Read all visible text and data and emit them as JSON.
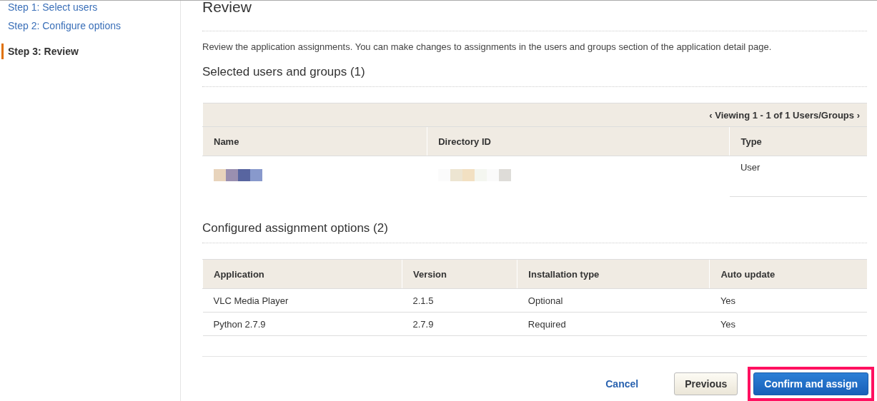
{
  "sidebar": {
    "steps": [
      {
        "label": "Step 1: Select users",
        "selected": false
      },
      {
        "label": "Step 2: Configure options",
        "selected": false
      },
      {
        "label": "Step 3: Review",
        "selected": true
      }
    ]
  },
  "page": {
    "title": "Review",
    "description": "Review the application assignments. You can make changes to assignments in the users and groups section of the application detail page."
  },
  "users_section": {
    "title": "Selected users and groups (1)",
    "pager": {
      "prev": "‹",
      "text": "Viewing 1 - 1 of 1 Users/Groups",
      "next": "›"
    },
    "columns": [
      "Name",
      "Directory ID",
      "Type"
    ],
    "rows": [
      {
        "type": "User"
      }
    ]
  },
  "options_section": {
    "title": "Configured assignment options (2)",
    "columns": [
      "Application",
      "Version",
      "Installation type",
      "Auto update"
    ],
    "rows": [
      [
        "VLC Media Player",
        "2.1.5",
        "Optional",
        "Yes"
      ],
      [
        "Python 2.7.9",
        "2.7.9",
        "Required",
        "Yes"
      ]
    ]
  },
  "buttons": {
    "cancel": "Cancel",
    "previous": "Previous",
    "confirm": "Confirm and assign"
  }
}
